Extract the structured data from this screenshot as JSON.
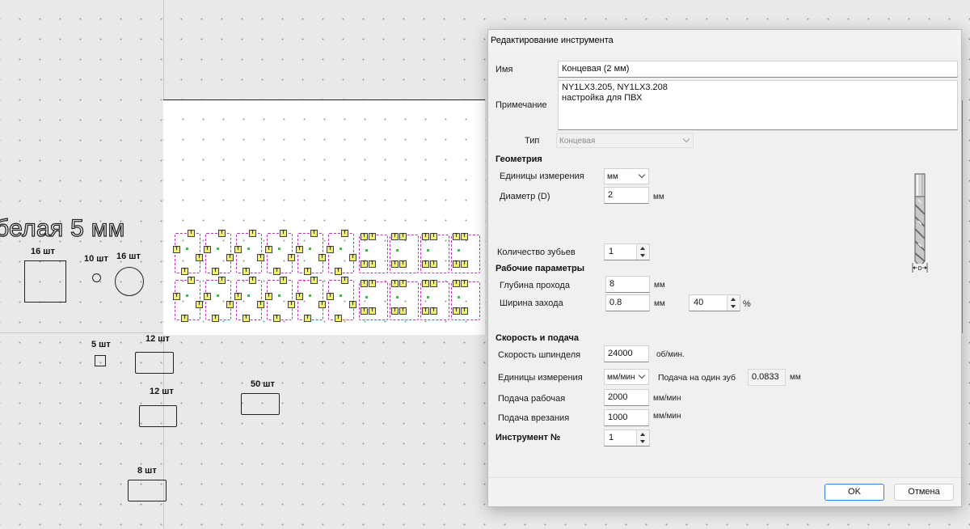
{
  "canvas": {
    "big_text": "белая 5 мм",
    "labels": [
      "16 шт",
      "10 шт",
      "16 шт",
      "5 шт",
      "12 шт",
      "12 шт",
      "50 шт",
      "8 шт"
    ]
  },
  "dialog": {
    "title": "Редактирование инструмента",
    "name_label": "Имя",
    "name_value": "Концевая (2 мм)",
    "note_label": "Примечание",
    "note_value": "NY1LX3.205, NY1LX3.208\nнастройка для ПВХ",
    "type_label": "Тип",
    "type_value": "Концевая",
    "geometry": {
      "header": "Геометрия",
      "units_label": "Единицы измерения",
      "units_value": "мм",
      "diameter_label": "Диаметр (D)",
      "diameter_value": "2",
      "diameter_unit": "мм",
      "teeth_label": "Количество зубьев",
      "teeth_value": "1",
      "image_caption": "D"
    },
    "work": {
      "header": "Рабочие параметры",
      "depth_label": "Глубина прохода",
      "depth_value": "8",
      "depth_unit": "мм",
      "stepover_label": "Ширина захода",
      "stepover_value": "0.8",
      "stepover_unit": "мм",
      "stepover_percent": "40",
      "percent_sign": "%"
    },
    "speed": {
      "header": "Скорость и подача",
      "spindle_label": "Скорость шпинделя",
      "spindle_value": "24000",
      "spindle_unit": "об/мин.",
      "units_label": "Единицы измерения",
      "units_value": "мм/мин",
      "per_tooth_label": "Подача на один зуб",
      "per_tooth_value": "0.0833",
      "per_tooth_unit": "мм",
      "feed_label": "Подача рабочая",
      "feed_value": "2000",
      "feed_unit": "мм/мин",
      "plunge_label": "Подача врезания",
      "plunge_value": "1000",
      "plunge_unit": "мм/мин"
    },
    "tool_number_label": "Инструмент №",
    "tool_number_value": "1",
    "ok_label": "OK",
    "cancel_label": "Отмена"
  }
}
